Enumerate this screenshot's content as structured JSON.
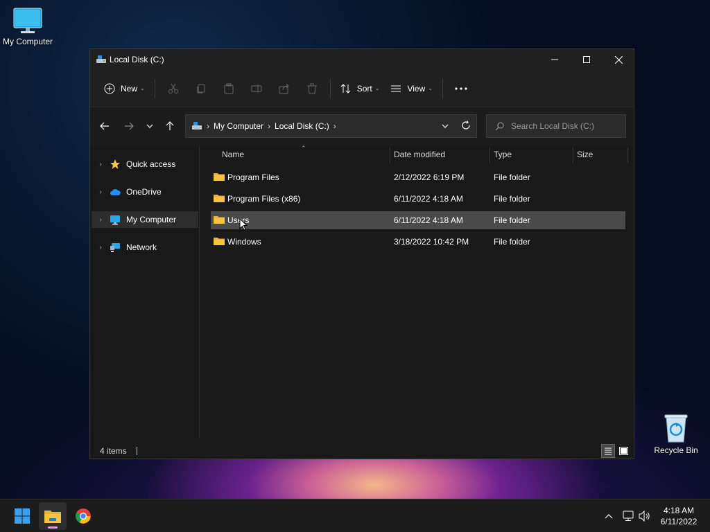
{
  "desktop": {
    "my_computer_label": "My Computer",
    "recycle_bin_label": "Recycle Bin"
  },
  "window": {
    "title": "Local Disk (C:)",
    "toolbar": {
      "new_label": "New",
      "sort_label": "Sort",
      "view_label": "View"
    },
    "address": {
      "crumbs": [
        "My Computer",
        "Local Disk (C:)"
      ]
    },
    "search": {
      "placeholder": "Search Local Disk (C:)"
    },
    "nav_pane": {
      "items": [
        {
          "label": "Quick access",
          "icon": "star-icon"
        },
        {
          "label": "OneDrive",
          "icon": "cloud-icon"
        },
        {
          "label": "My Computer",
          "icon": "computer-icon",
          "selected": true
        },
        {
          "label": "Network",
          "icon": "network-icon"
        }
      ]
    },
    "columns": {
      "name": "Name",
      "date": "Date modified",
      "type": "Type",
      "size": "Size"
    },
    "files": [
      {
        "name": "Program Files",
        "date": "2/12/2022 6:19 PM",
        "type": "File folder",
        "size": ""
      },
      {
        "name": "Program Files (x86)",
        "date": "6/11/2022 4:18 AM",
        "type": "File folder",
        "size": ""
      },
      {
        "name": "Users",
        "date": "6/11/2022 4:18 AM",
        "type": "File folder",
        "size": "",
        "selected": true
      },
      {
        "name": "Windows",
        "date": "3/18/2022 10:42 PM",
        "type": "File folder",
        "size": ""
      }
    ],
    "status": {
      "item_count": "4 items"
    }
  },
  "taskbar": {
    "clock_time": "4:18 AM",
    "clock_date": "6/11/2022"
  },
  "colors": {
    "accent": "#0078d4",
    "folder": "#f5c542",
    "window_bg": "#191919",
    "selection": "#4a4a4a"
  }
}
